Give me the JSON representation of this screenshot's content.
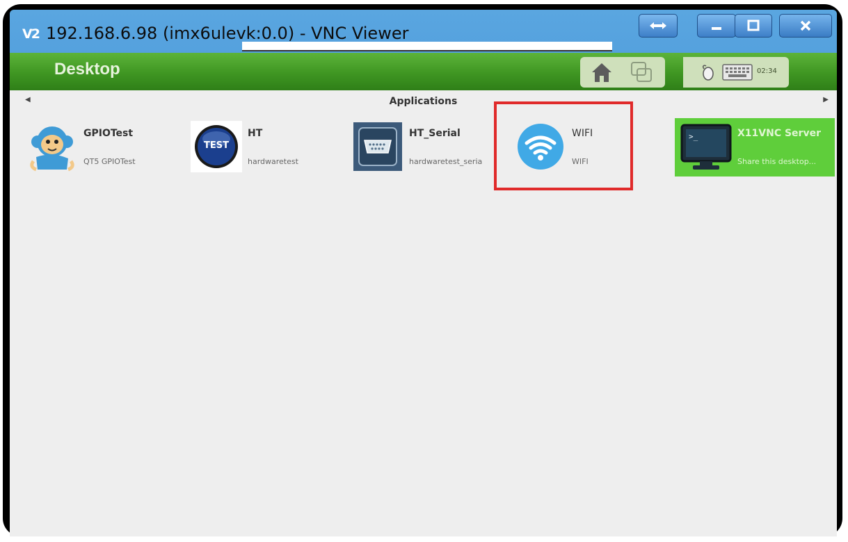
{
  "window": {
    "icon_label": "V2",
    "title": "192.168.6.98 (imx6ulevk:0.0) - VNC Viewer",
    "controls": [
      "resize-toggle-icon",
      "minimize-icon",
      "maximize-icon",
      "close-icon"
    ]
  },
  "header": {
    "title": "Desktop",
    "clock": "02:34",
    "icons": [
      "home-icon",
      "window-switch-icon",
      "mouse-icon",
      "keyboard-icon"
    ]
  },
  "applications": {
    "title": "Applications",
    "items": [
      {
        "name": "GPIOTest",
        "description": "QT5 GPIOTest",
        "icon": "monkey-icon"
      },
      {
        "name": "HT",
        "description": "hardwaretest",
        "icon": "test-badge-icon",
        "icon_text": "TEST"
      },
      {
        "name": "HT_Serial",
        "description": "hardwaretest_seria",
        "icon": "serial-port-icon"
      },
      {
        "name": "WIFI",
        "description": "WIFI",
        "icon": "wifi-icon"
      },
      {
        "name": "X11VNC Server",
        "description": "Share this desktop...",
        "icon": "terminal-icon",
        "icon_text": ">_",
        "selected": true
      }
    ]
  },
  "colors": {
    "header_green": "#3f9622",
    "selected_tile": "#5fce3b",
    "highlight_red": "#e02a2a",
    "titlebar_blue": "#3f8ed6"
  }
}
